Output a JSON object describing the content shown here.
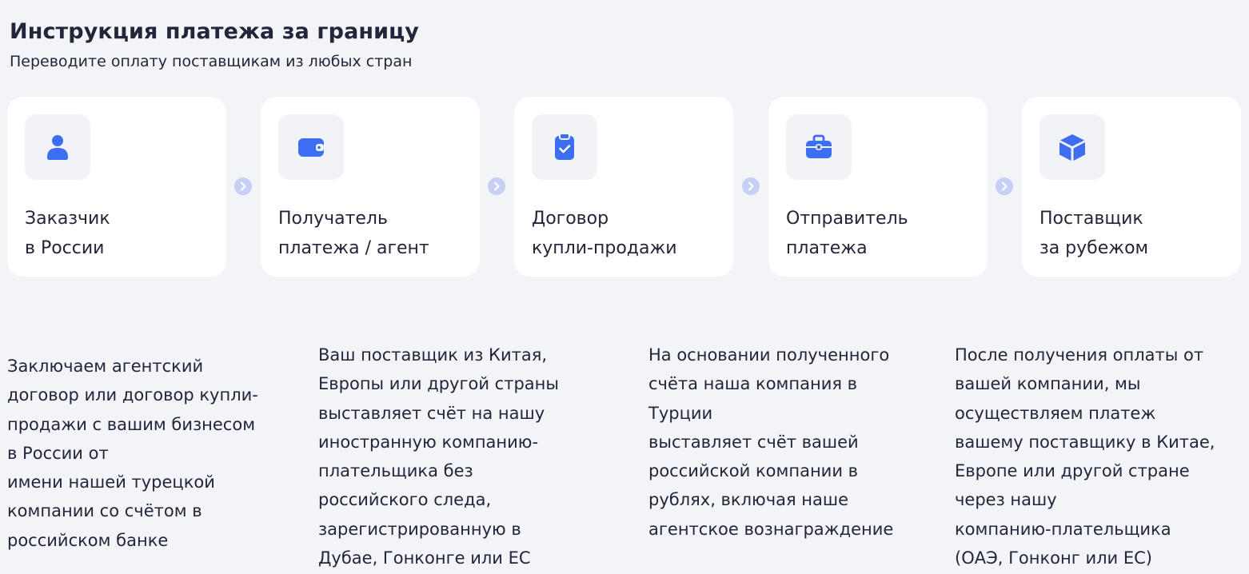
{
  "header": {
    "title": "Инструкция платежа за границу",
    "subtitle": "Переводите оплату поставщикам из любых стран"
  },
  "colors": {
    "accent": "#3d6df2",
    "background": "#f3f4f8",
    "card": "#ffffff",
    "icon_tile": "#f2f3f7",
    "arrow": "#c6cff5"
  },
  "steps": [
    {
      "icon": "user-icon",
      "label": "Заказчик\nв России"
    },
    {
      "icon": "wallet-icon",
      "label": "Получатель\nплатежа / агент"
    },
    {
      "icon": "clipboard-check-icon",
      "label": "Договор\nкупли-продажи"
    },
    {
      "icon": "briefcase-icon",
      "label": "Отправитель\nплатежа"
    },
    {
      "icon": "box-icon",
      "label": "Поставщик\nза рубежом"
    }
  ],
  "descriptions": [
    "Заключаем агентский\nдоговор или договор купли-\nпродажи с вашим бизнесом\nв России от\nимени нашей турецкой\nкомпании со счётом в\nроссийском банке",
    "Ваш поставщик из Китая,\nЕвропы или другой страны\nвыставляет счёт на нашу\nиностранную компанию-\nплательщика без\nроссийского следа,\nзарегистрированную в\nДубае, Гонконге или ЕС",
    "На основании полученного\nсчёта наша компания в\nТурции\nвыставляет счёт вашей\nроссийской компании в\nрублях, включая наше\nагентское вознаграждение",
    "После получения оплаты от\nвашей компании, мы\nосуществляем платеж\nвашему поставщику в Китае,\nЕвропе или другой стране\nчерез нашу\nкомпанию-плательщика\n(ОАЭ, Гонконг или ЕС)"
  ]
}
